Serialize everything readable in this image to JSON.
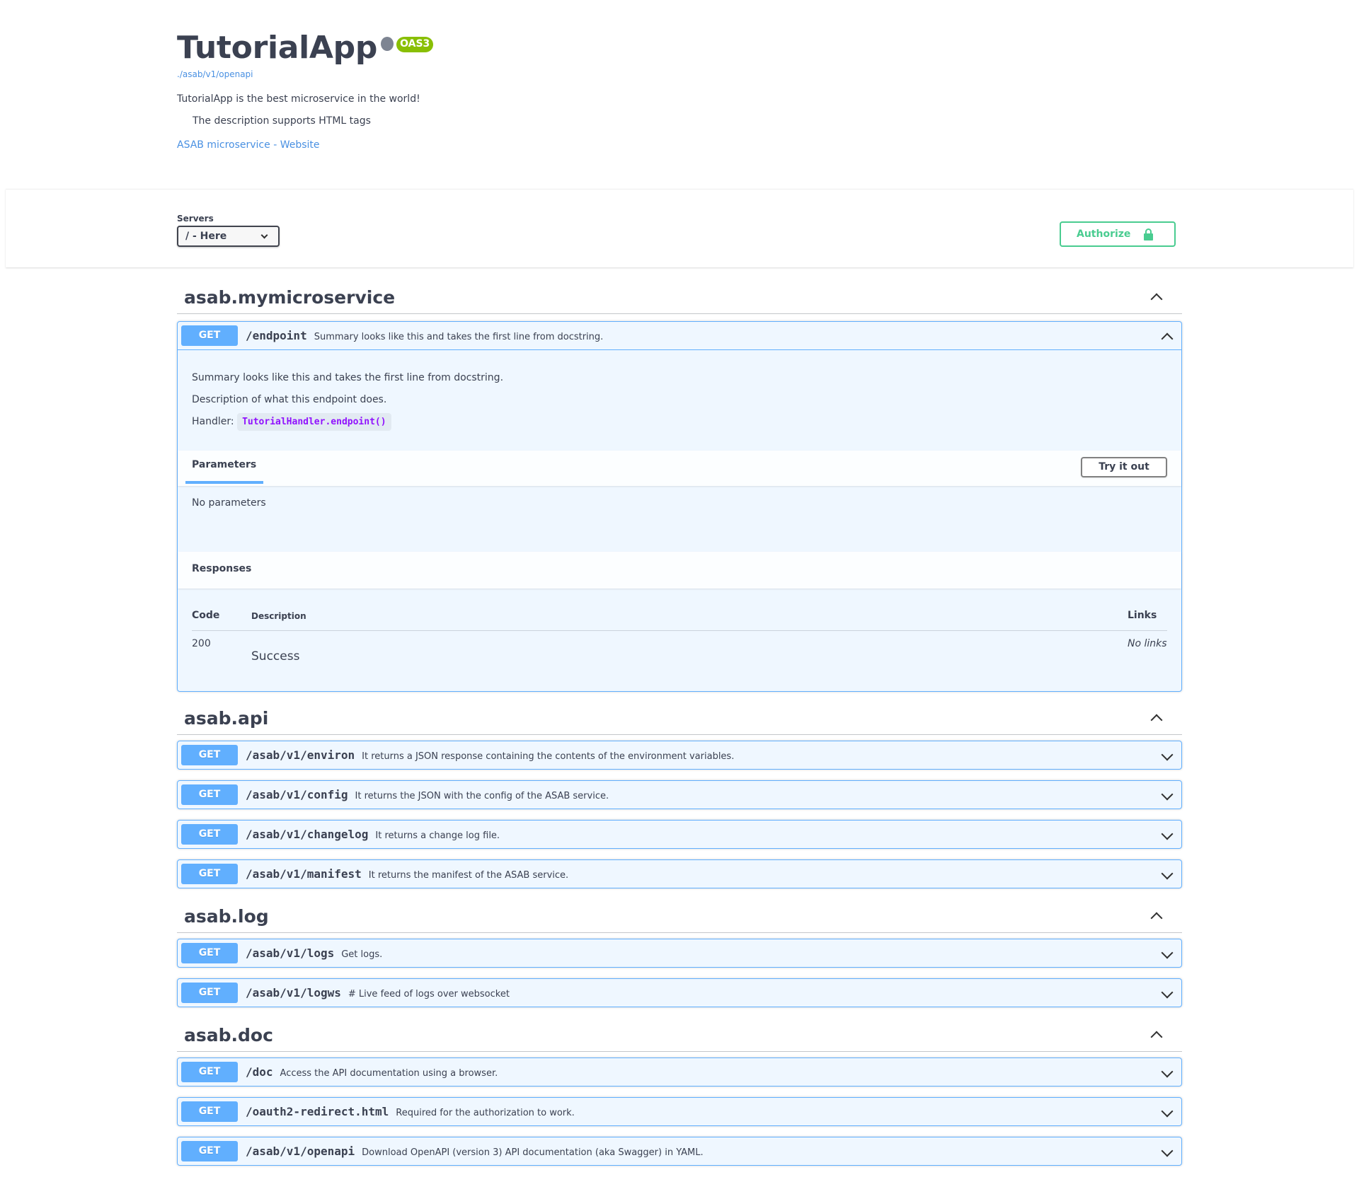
{
  "info": {
    "title": "TutorialApp",
    "oas_badge": "OAS3",
    "spec_url": "./asab/v1/openapi",
    "description": "TutorialApp is the best microservice in the world!",
    "description2": "The description supports HTML tags",
    "website_link": "ASAB microservice - Website"
  },
  "servers": {
    "label": "Servers",
    "selected": "/ - Here"
  },
  "authorize": {
    "label": "Authorize"
  },
  "tags": [
    {
      "name": "asab.mymicroservice",
      "operations": [
        {
          "method": "GET",
          "path": "/endpoint",
          "summary": "Summary looks like this and takes the first line from docstring."
        }
      ]
    },
    {
      "name": "asab.api",
      "operations": [
        {
          "method": "GET",
          "path": "/asab/v1/environ",
          "summary": "It returns a JSON response containing the contents of the environment variables."
        },
        {
          "method": "GET",
          "path": "/asab/v1/config",
          "summary": "It returns the JSON with the config of the ASAB service."
        },
        {
          "method": "GET",
          "path": "/asab/v1/changelog",
          "summary": "It returns a change log file."
        },
        {
          "method": "GET",
          "path": "/asab/v1/manifest",
          "summary": "It returns the manifest of the ASAB service."
        }
      ]
    },
    {
      "name": "asab.log",
      "operations": [
        {
          "method": "GET",
          "path": "/asab/v1/logs",
          "summary": "Get logs."
        },
        {
          "method": "GET",
          "path": "/asab/v1/logws",
          "summary": "# Live feed of logs over websocket"
        }
      ]
    },
    {
      "name": "asab.doc",
      "operations": [
        {
          "method": "GET",
          "path": "/doc",
          "summary": "Access the API documentation using a browser."
        },
        {
          "method": "GET",
          "path": "/oauth2-redirect.html",
          "summary": "Required for the authorization to work."
        },
        {
          "method": "GET",
          "path": "/asab/v1/openapi",
          "summary": "Download OpenAPI (version 3) API documentation (aka Swagger) in YAML."
        }
      ]
    }
  ],
  "expanded": {
    "summary_text": "Summary looks like this and takes the first line from docstring.",
    "description_text": "Description of what this endpoint does.",
    "handler_label": "Handler:",
    "handler_code": "TutorialHandler.endpoint()",
    "parameters_tab": "Parameters",
    "try_it_out": "Try it out",
    "no_parameters": "No parameters",
    "responses_title": "Responses",
    "col_code": "Code",
    "col_description": "Description",
    "col_links": "Links",
    "response_code": "200",
    "response_description": "Success",
    "response_links": "No links"
  },
  "colors": {
    "get_method": "#61affe",
    "authorize": "#49cc90",
    "oas_badge": "#89bf04",
    "handler_code": "#9012fe"
  }
}
